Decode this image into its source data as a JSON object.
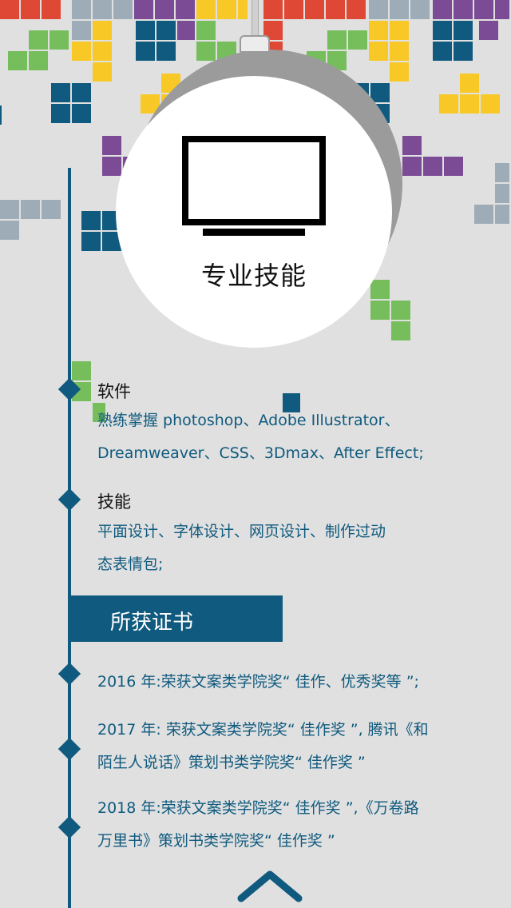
{
  "colors": {
    "accent": "#0f5a7e",
    "background": "#e0e0e0",
    "block_red": "#e04836",
    "block_green": "#76bd5c",
    "block_yellow": "#f7c826",
    "block_purple": "#7b4b96",
    "block_navy": "#0f5a7e",
    "block_gray": "#9eacb8"
  },
  "header": {
    "icon": "monitor-icon",
    "title": "专业技能"
  },
  "skills": [
    {
      "heading": "软件",
      "lines": [
        "熟练掌握 photoshop、Adobe Illustrator、",
        "Dreamweaver、CSS、3Dmax、After Effect;"
      ]
    },
    {
      "heading": "技能",
      "lines": [
        "平面设计、字体设计、网页设计、制作过动",
        "态表情包;"
      ]
    }
  ],
  "certificates": {
    "title": "所获证书",
    "items": [
      {
        "lines": [
          "2016 年:荣获文案类学院奖“ 佳作、优秀奖等 ”;"
        ]
      },
      {
        "lines": [
          "2017 年: 荣获文案类学院奖“ 佳作奖 ”, 腾讯《和",
          "陌生人说话》策划书类学院奖“ 佳作奖 ”"
        ]
      },
      {
        "lines": [
          "2018 年:荣获文案类学院奖“ 佳作奖 ”,《万卷路",
          "万里书》策划书类学院奖“ 佳作奖 ”"
        ]
      }
    ]
  },
  "footer": {
    "scroll_up_icon": "chevron-up-icon"
  }
}
